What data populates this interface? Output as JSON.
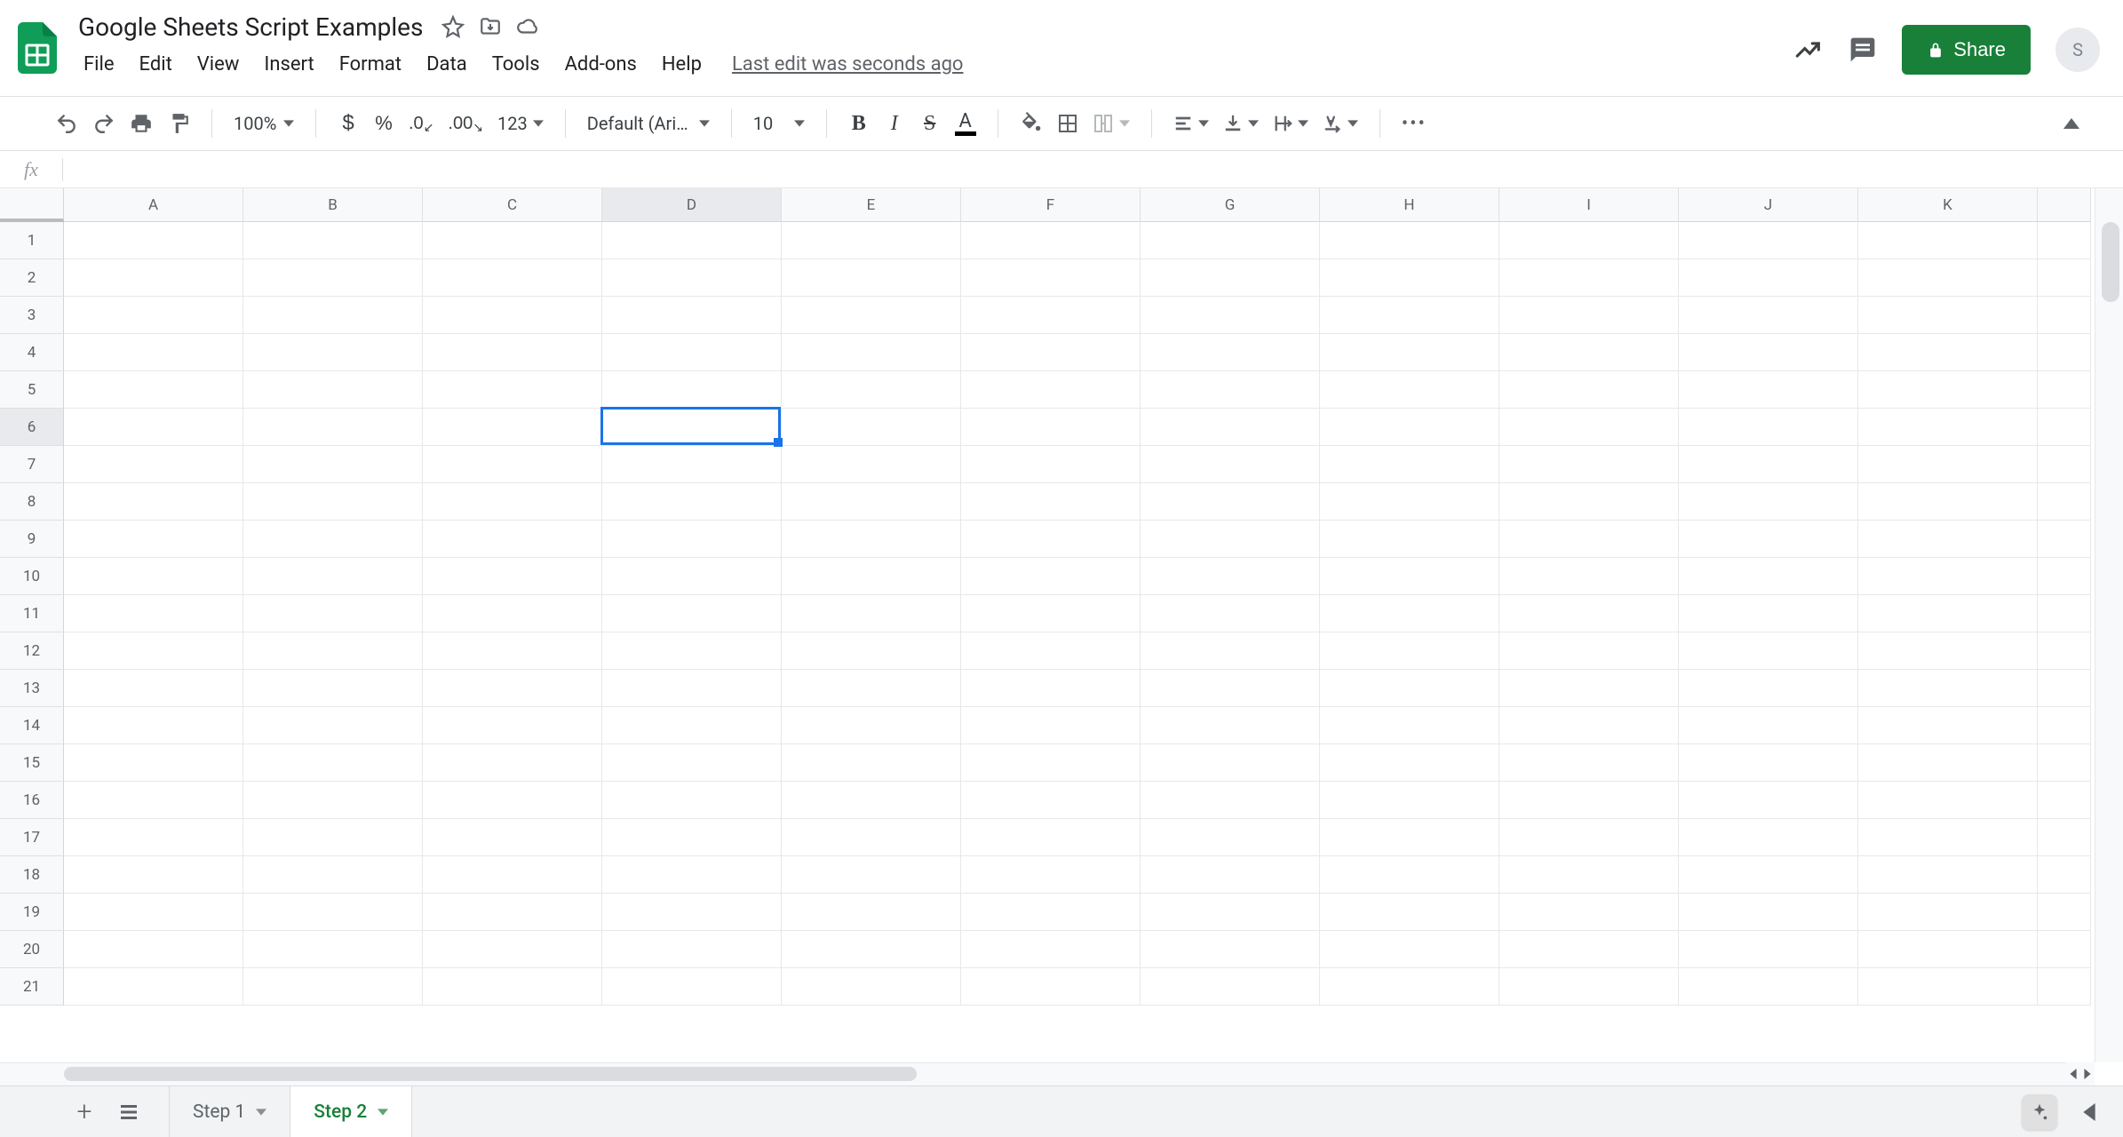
{
  "doc": {
    "title": "Google Sheets Script Examples",
    "last_edit": "Last edit was seconds ago"
  },
  "menus": [
    "File",
    "Edit",
    "View",
    "Insert",
    "Format",
    "Data",
    "Tools",
    "Add-ons",
    "Help"
  ],
  "share": {
    "label": "Share"
  },
  "avatar": {
    "initial": "S"
  },
  "toolbar": {
    "zoom": "100%",
    "font": "Default (Ari…",
    "font_size": "10",
    "number_format": "123"
  },
  "formula": {
    "fx": "fx",
    "value": ""
  },
  "grid": {
    "columns": [
      "A",
      "B",
      "C",
      "D",
      "E",
      "F",
      "G",
      "H",
      "I",
      "J",
      "K"
    ],
    "rows": [
      1,
      2,
      3,
      4,
      5,
      6,
      7,
      8,
      9,
      10,
      11,
      12,
      13,
      14,
      15,
      16,
      17,
      18,
      19,
      20,
      21
    ],
    "selected_cell": {
      "col_index": 3,
      "row_index": 5,
      "ref": "D6"
    }
  },
  "tabs": {
    "items": [
      {
        "label": "Step 1",
        "active": false
      },
      {
        "label": "Step 2",
        "active": true
      }
    ]
  },
  "colors": {
    "brand_green": "#188038",
    "selection_blue": "#1a73e8"
  }
}
